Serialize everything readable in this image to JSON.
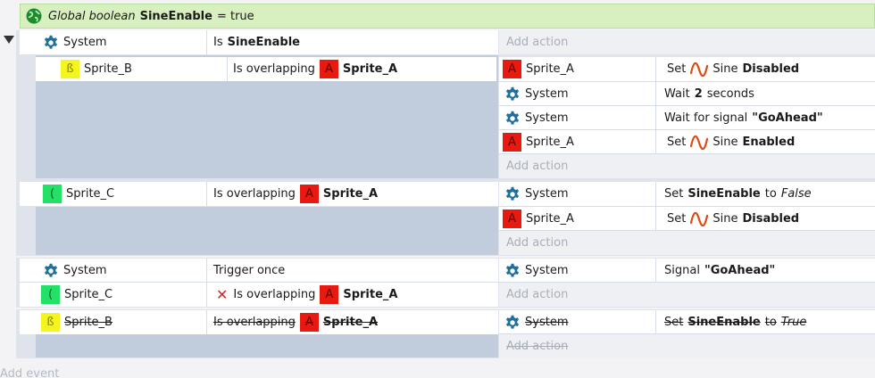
{
  "global_var": {
    "prefix": "Global boolean",
    "name": "SineEnable",
    "suffix": "= true"
  },
  "add_action": "Add action",
  "add_event": "Add event",
  "system": "System",
  "e1": {
    "cond": {
      "prefix": "Is",
      "name": "SineEnable"
    }
  },
  "e2": {
    "object": "Sprite_B",
    "cond": {
      "text": "Is overlapping",
      "target": "Sprite_A"
    },
    "actions": [
      {
        "object": "Sprite_A",
        "prefix": "Set",
        "behavior": "Sine",
        "value": "Disabled"
      },
      {
        "object": "System",
        "prefix": "Wait",
        "value": "2",
        "suffix": "seconds"
      },
      {
        "object": "System",
        "prefix": "Wait for signal",
        "value": "\"GoAhead\""
      },
      {
        "object": "Sprite_A",
        "prefix": "Set",
        "behavior": "Sine",
        "value": "Enabled"
      }
    ]
  },
  "e3": {
    "object": "Sprite_C",
    "cond": {
      "text": "Is overlapping",
      "target": "Sprite_A"
    },
    "actions": [
      {
        "object": "System",
        "prefix": "Set",
        "name": "SineEnable",
        "mid": "to",
        "value": "False"
      },
      {
        "object": "Sprite_A",
        "prefix": "Set",
        "behavior": "Sine",
        "value": "Disabled"
      }
    ]
  },
  "e4": {
    "cond1": {
      "object": "System",
      "text": "Trigger once"
    },
    "cond2": {
      "object": "Sprite_C",
      "text": "Is overlapping",
      "target": "Sprite_A"
    },
    "action": {
      "object": "System",
      "prefix": "Signal",
      "value": "\"GoAhead\""
    }
  },
  "e5": {
    "object": "Sprite_B",
    "cond": {
      "text": "Is overlapping",
      "target": "Sprite_A"
    },
    "action": {
      "object": "System",
      "prefix": "Set",
      "name": "SineEnable",
      "mid": "to",
      "value": "True"
    }
  },
  "colors": {
    "global_bg": "#d8f0c0",
    "panel": "#c1ccdd",
    "sprite_a": "#e8190f",
    "sprite_b": "#f4f41f",
    "sprite_c": "#23e066",
    "gear": "#1f6f9c",
    "sine": "#e04a10"
  }
}
